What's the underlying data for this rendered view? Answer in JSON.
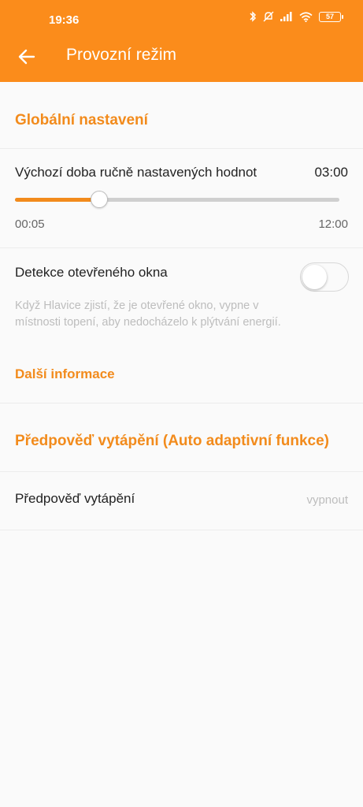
{
  "status_bar": {
    "time": "19:36",
    "battery": "57",
    "icons": [
      "bluetooth-icon",
      "mute-icon",
      "signal-icon",
      "wifi-icon",
      "battery-icon"
    ]
  },
  "app_bar": {
    "title": "Provozní režim",
    "back_icon": "arrow-left-icon"
  },
  "colors": {
    "accent": "#fb8c1b",
    "accent_text": "#f28b1c",
    "background": "#fafafa"
  },
  "global_section": {
    "heading": "Globální nastavení",
    "manual_duration": {
      "label": "Výchozí doba ručně nastavených hodnot",
      "value": "03:00",
      "min_label": "00:05",
      "max_label": "12:00",
      "slider_fraction": 0.26
    },
    "window_detection": {
      "label": "Detekce otevřeného okna",
      "enabled": false,
      "description": "Když Hlavice zjistí, že je otevřené okno, vypne v místnosti topení, aby nedocházelo k plýtvání energií.",
      "more_info": "Další informace"
    }
  },
  "forecast_section": {
    "heading": "Předpověď vytápění (Auto adaptivní funkce)",
    "row": {
      "label": "Předpověď vytápění",
      "value": "vypnout"
    }
  }
}
